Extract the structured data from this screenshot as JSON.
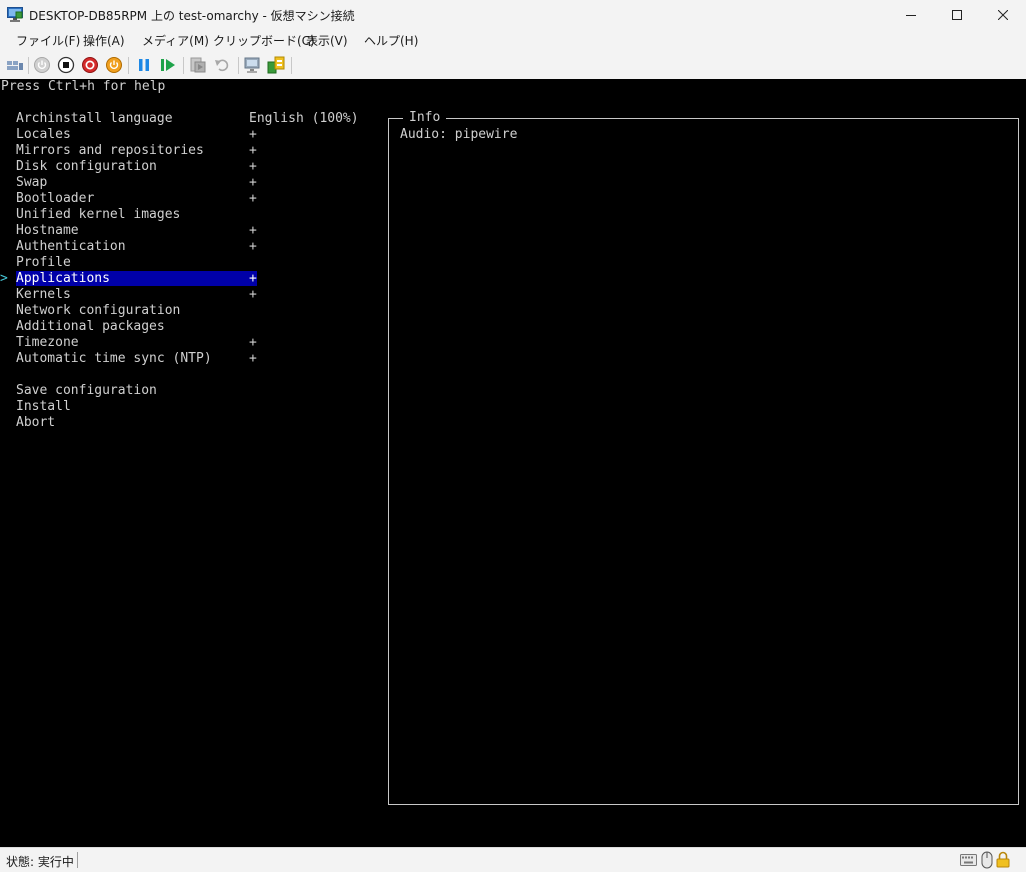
{
  "window": {
    "title": "DESKTOP-DB85RPM 上の test-omarchy  - 仮想マシン接続",
    "icon": "vm-connect-icon"
  },
  "menu": [
    "ファイル(F)",
    "操作(A)",
    "メディア(M)",
    "クリップボード(C)",
    "表示(V)",
    "ヘルプ(H)"
  ],
  "toolbar": {
    "icons": [
      "ctrl-alt-del-icon",
      "start-icon",
      "turn-off-icon",
      "shut-down-icon",
      "save-icon",
      "pause-icon",
      "resume-icon",
      "checkpoint-icon",
      "revert-icon",
      "enhanced-session-icon",
      "share-icon"
    ]
  },
  "terminal": {
    "help": "Press Ctrl+h for help",
    "menu": [
      {
        "label": "Archinstall language",
        "value": "English (100%)"
      },
      {
        "label": "Locales",
        "value": "+"
      },
      {
        "label": "Mirrors and repositories",
        "value": "+"
      },
      {
        "label": "Disk configuration",
        "value": "+"
      },
      {
        "label": "Swap",
        "value": "+"
      },
      {
        "label": "Bootloader",
        "value": "+"
      },
      {
        "label": "Unified kernel images",
        "value": ""
      },
      {
        "label": "Hostname",
        "value": "+"
      },
      {
        "label": "Authentication",
        "value": "+"
      },
      {
        "label": "Profile",
        "value": ""
      },
      {
        "label": "Applications",
        "value": "+"
      },
      {
        "label": "Kernels",
        "value": "+"
      },
      {
        "label": "Network configuration",
        "value": ""
      },
      {
        "label": "Additional packages",
        "value": ""
      },
      {
        "label": "Timezone",
        "value": "+"
      },
      {
        "label": "Automatic time sync (NTP)",
        "value": "+"
      }
    ],
    "actions": [
      "Save configuration",
      "Install",
      "Abort"
    ],
    "selected_index": 10,
    "cursor": ">",
    "info_title": "Info",
    "info_text": "Audio: pipewire",
    "highlight_color": "#0000a8",
    "cursor_color": "#46c8d8"
  },
  "status": {
    "text": "状態: 実行中",
    "icons": [
      "keyboard-icon",
      "mouse-icon",
      "lock-icon"
    ]
  }
}
